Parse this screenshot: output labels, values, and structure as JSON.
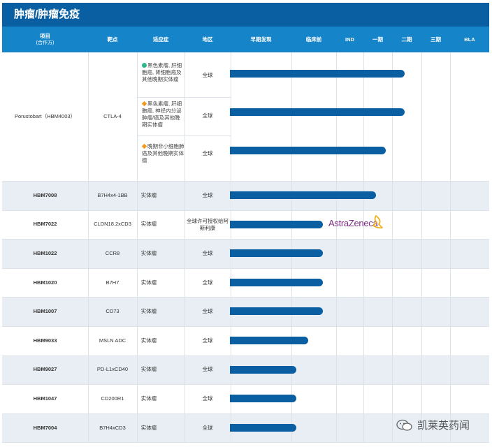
{
  "title": "肿瘤/肿瘤免疫",
  "headers": {
    "project": "项目",
    "project_sub": "(合作方)",
    "target": "靶点",
    "indication": "适应症",
    "region": "地区",
    "discovery": "早期发现",
    "preclinical": "临床前",
    "ind": "IND",
    "phase1": "一期",
    "phase2": "二期",
    "phase3": "三期",
    "bla": "BLA"
  },
  "group1": {
    "project": "Porustobart（HBM4003）",
    "target": "CTLA-4",
    "rows": [
      {
        "marker": "dot",
        "indication": "黑色素瘤, 肝细胞癌, 肾细胞癌及其他晚期实体瘤",
        "region": "全球",
        "stage_progress": 0.845
      },
      {
        "marker": "diamond",
        "indication": "黑色素瘤, 肝细胞癌, 神经内分泌肿瘤/癌及其他晚期实体瘤",
        "region": "全球",
        "stage_progress": 0.845
      },
      {
        "marker": "diamond",
        "indication": "晚期非小细胞肺癌及其他晚期实体瘤",
        "region": "全球",
        "stage_progress": 0.755
      }
    ]
  },
  "rows": [
    {
      "project": "HBM7008",
      "target": "B7H4x4-1BB",
      "indication": "实体瘤",
      "region": "全球",
      "stage_progress": 0.705
    },
    {
      "project": "HBM7022",
      "target": "CLDN18.2xCD3",
      "indication": "实体瘤",
      "region": "全球许可授权给阿斯利康",
      "stage_progress": 0.45,
      "partner": "AstraZeneca"
    },
    {
      "project": "HBM1022",
      "target": "CCR8",
      "indication": "实体瘤",
      "region": "全球",
      "stage_progress": 0.45
    },
    {
      "project": "HBM1020",
      "target": "B7H7",
      "indication": "实体瘤",
      "region": "全球",
      "stage_progress": 0.45
    },
    {
      "project": "HBM1007",
      "target": "CD73",
      "indication": "实体瘤",
      "region": "全球",
      "stage_progress": 0.45
    },
    {
      "project": "HBM9033",
      "target": "MSLN ADC",
      "indication": "实体瘤",
      "region": "全球",
      "stage_progress": 0.38
    },
    {
      "project": "HBM9027",
      "target": "PD-L1xCD40",
      "indication": "实体瘤",
      "region": "全球",
      "stage_progress": 0.32
    },
    {
      "project": "HBM1047",
      "target": "CD200R1",
      "indication": "实体瘤",
      "region": "全球",
      "stage_progress": 0.32
    },
    {
      "project": "HBM7004",
      "target": "B7H4xCD3",
      "indication": "实体瘤",
      "region": "全球",
      "stage_progress": 0.32
    }
  ],
  "watermark": "凯莱英药闻",
  "colors": {
    "title_bg": "#0a5fa3",
    "header_bg": "#1684c9",
    "bar": "#0a5fa3",
    "alt_row": "#e8eef4"
  }
}
